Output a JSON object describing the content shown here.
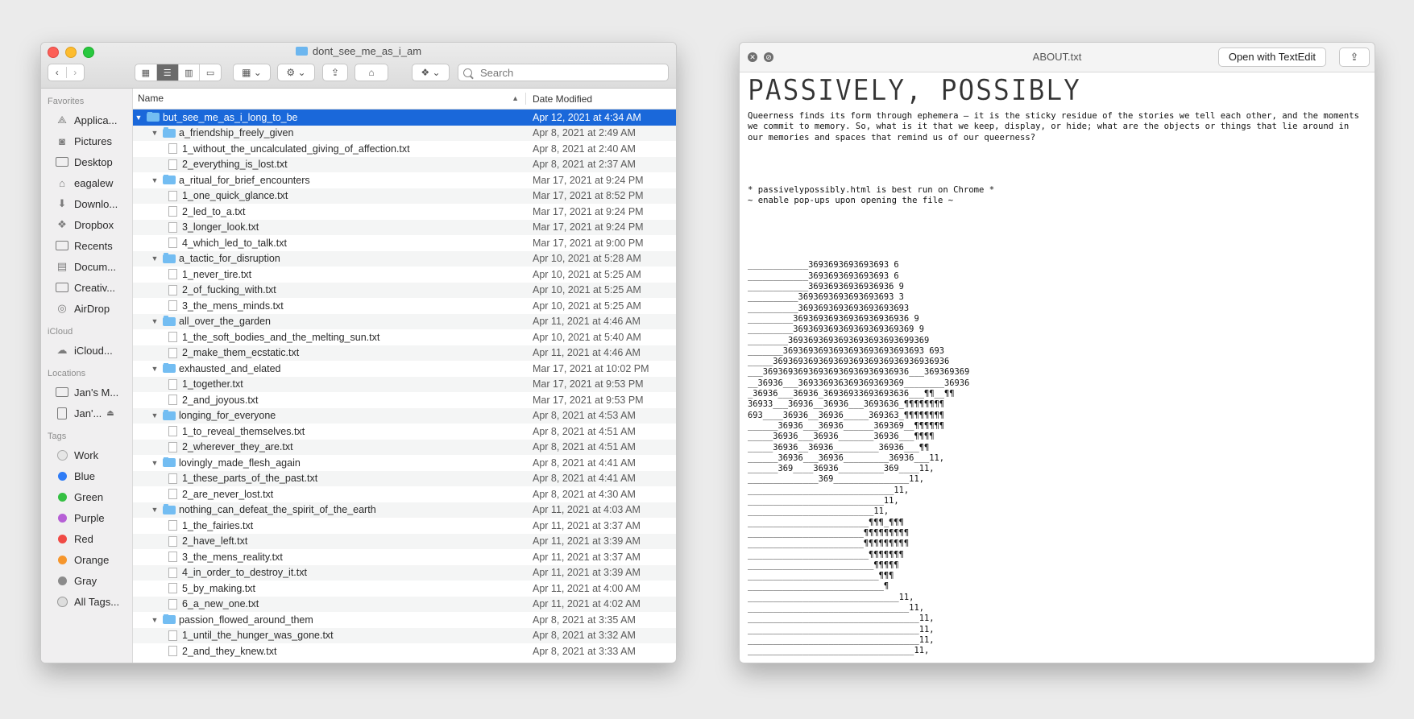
{
  "finder": {
    "window_title": "dont_see_me_as_i_am",
    "search_placeholder": "Search",
    "columns": {
      "name": "Name",
      "date": "Date Modified"
    },
    "sidebar": {
      "favorites_header": "Favorites",
      "favorites": [
        {
          "label": "Applica...",
          "icon": "applications-icon"
        },
        {
          "label": "Pictures",
          "icon": "pictures-icon"
        },
        {
          "label": "Desktop",
          "icon": "desktop-icon"
        },
        {
          "label": "eagalew",
          "icon": "home-icon"
        },
        {
          "label": "Downlo...",
          "icon": "downloads-icon"
        },
        {
          "label": "Dropbox",
          "icon": "dropbox-icon"
        },
        {
          "label": "Recents",
          "icon": "recents-icon"
        },
        {
          "label": "Docum...",
          "icon": "documents-icon"
        },
        {
          "label": "Creativ...",
          "icon": "folder-icon"
        },
        {
          "label": "AirDrop",
          "icon": "airdrop-icon"
        }
      ],
      "icloud_header": "iCloud",
      "icloud": [
        {
          "label": "iCloud...",
          "icon": "cloud-icon"
        }
      ],
      "locations_header": "Locations",
      "locations": [
        {
          "label": "Jan's M...",
          "icon": "computer-icon"
        },
        {
          "label": "Jan'...",
          "icon": "disk-icon"
        }
      ],
      "tags_header": "Tags",
      "tags": [
        {
          "label": "Work",
          "color": "#e6e6e6"
        },
        {
          "label": "Blue",
          "color": "#2f7cf6"
        },
        {
          "label": "Green",
          "color": "#35c043"
        },
        {
          "label": "Purple",
          "color": "#b65fd6"
        },
        {
          "label": "Red",
          "color": "#f04a45"
        },
        {
          "label": "Orange",
          "color": "#f6962c"
        },
        {
          "label": "Gray",
          "color": "#8b8b8b"
        },
        {
          "label": "All Tags...",
          "color": ""
        }
      ]
    },
    "rows": [
      {
        "level": 0,
        "type": "folder",
        "name": "but_see_me_as_i_long_to_be",
        "date": "Apr 12, 2021 at 4:34 AM",
        "selected": true
      },
      {
        "level": 1,
        "type": "folder",
        "name": "a_friendship_freely_given",
        "date": "Apr 8, 2021 at 2:49 AM"
      },
      {
        "level": 2,
        "type": "file",
        "name": "1_without_the_uncalculated_giving_of_affection.txt",
        "date": "Apr 8, 2021 at 2:40 AM"
      },
      {
        "level": 2,
        "type": "file",
        "name": "2_everything_is_lost.txt",
        "date": "Apr 8, 2021 at 2:37 AM"
      },
      {
        "level": 1,
        "type": "folder",
        "name": "a_ritual_for_brief_encounters",
        "date": "Mar 17, 2021 at 9:24 PM"
      },
      {
        "level": 2,
        "type": "file",
        "name": "1_one_quick_glance.txt",
        "date": "Mar 17, 2021 at 8:52 PM"
      },
      {
        "level": 2,
        "type": "file",
        "name": "2_led_to_a.txt",
        "date": "Mar 17, 2021 at 9:24 PM"
      },
      {
        "level": 2,
        "type": "file",
        "name": "3_longer_look.txt",
        "date": "Mar 17, 2021 at 9:24 PM"
      },
      {
        "level": 2,
        "type": "file",
        "name": "4_which_led_to_talk.txt",
        "date": "Mar 17, 2021 at 9:00 PM"
      },
      {
        "level": 1,
        "type": "folder",
        "name": "a_tactic_for_disruption",
        "date": "Apr 10, 2021 at 5:28 AM"
      },
      {
        "level": 2,
        "type": "file",
        "name": "1_never_tire.txt",
        "date": "Apr 10, 2021 at 5:25 AM"
      },
      {
        "level": 2,
        "type": "file",
        "name": "2_of_fucking_with.txt",
        "date": "Apr 10, 2021 at 5:25 AM"
      },
      {
        "level": 2,
        "type": "file",
        "name": "3_the_mens_minds.txt",
        "date": "Apr 10, 2021 at 5:25 AM"
      },
      {
        "level": 1,
        "type": "folder",
        "name": "all_over_the_garden",
        "date": "Apr 11, 2021 at 4:46 AM"
      },
      {
        "level": 2,
        "type": "file",
        "name": "1_the_soft_bodies_and_the_melting_sun.txt",
        "date": "Apr 10, 2021 at 5:40 AM"
      },
      {
        "level": 2,
        "type": "file",
        "name": "2_make_them_ecstatic.txt",
        "date": "Apr 11, 2021 at 4:46 AM"
      },
      {
        "level": 1,
        "type": "folder",
        "name": "exhausted_and_elated",
        "date": "Mar 17, 2021 at 10:02 PM"
      },
      {
        "level": 2,
        "type": "file",
        "name": "1_together.txt",
        "date": "Mar 17, 2021 at 9:53 PM"
      },
      {
        "level": 2,
        "type": "file",
        "name": "2_and_joyous.txt",
        "date": "Mar 17, 2021 at 9:53 PM"
      },
      {
        "level": 1,
        "type": "folder",
        "name": "longing_for_everyone",
        "date": "Apr 8, 2021 at 4:53 AM"
      },
      {
        "level": 2,
        "type": "file",
        "name": "1_to_reveal_themselves.txt",
        "date": "Apr 8, 2021 at 4:51 AM"
      },
      {
        "level": 2,
        "type": "file",
        "name": "2_wherever_they_are.txt",
        "date": "Apr 8, 2021 at 4:51 AM"
      },
      {
        "level": 1,
        "type": "folder",
        "name": "lovingly_made_flesh_again",
        "date": "Apr 8, 2021 at 4:41 AM"
      },
      {
        "level": 2,
        "type": "file",
        "name": "1_these_parts_of_the_past.txt",
        "date": "Apr 8, 2021 at 4:41 AM"
      },
      {
        "level": 2,
        "type": "file",
        "name": "2_are_never_lost.txt",
        "date": "Apr 8, 2021 at 4:30 AM"
      },
      {
        "level": 1,
        "type": "folder",
        "name": "nothing_can_defeat_the_spirit_of_the_earth",
        "date": "Apr 11, 2021 at 4:03 AM"
      },
      {
        "level": 2,
        "type": "file",
        "name": "1_the_fairies.txt",
        "date": "Apr 11, 2021 at 3:37 AM"
      },
      {
        "level": 2,
        "type": "file",
        "name": "2_have_left.txt",
        "date": "Apr 11, 2021 at 3:39 AM"
      },
      {
        "level": 2,
        "type": "file",
        "name": "3_the_mens_reality.txt",
        "date": "Apr 11, 2021 at 3:37 AM"
      },
      {
        "level": 2,
        "type": "file",
        "name": "4_in_order_to_destroy_it.txt",
        "date": "Apr 11, 2021 at 3:39 AM"
      },
      {
        "level": 2,
        "type": "file",
        "name": "5_by_making.txt",
        "date": "Apr 11, 2021 at 4:00 AM"
      },
      {
        "level": 2,
        "type": "file",
        "name": "6_a_new_one.txt",
        "date": "Apr 11, 2021 at 4:02 AM"
      },
      {
        "level": 1,
        "type": "folder",
        "name": "passion_flowed_around_them",
        "date": "Apr 8, 2021 at 3:35 AM"
      },
      {
        "level": 2,
        "type": "file",
        "name": "1_until_the_hunger_was_gone.txt",
        "date": "Apr 8, 2021 at 3:32 AM"
      },
      {
        "level": 2,
        "type": "file",
        "name": "2_and_they_knew.txt",
        "date": "Apr 8, 2021 at 3:33 AM"
      }
    ]
  },
  "quicklook": {
    "title": "ABOUT.txt",
    "open_button": "Open with TextEdit",
    "share_icon": "share-icon",
    "heading": "PASSIVELY, POSSIBLY",
    "paragraph": "Queerness finds its form through ephemera – it is the sticky residue of the stories we tell each other, and the moments we commit to memory. So, what is it that we keep, display, or hide; what are the objects or things that lie around in our memories and spaces that remind us of our queerness?",
    "note": "* passivelypossibly.html is best run on Chrome *\n~ enable pop-ups upon opening the file ~",
    "ascii_art": "____________3693693693693693 6\n____________3693693693693693 6\n____________36936936936936936 9\n__________3693693693693693693 3\n__________3693693693693693693693\n_________36936936936936936936936 9\n_________369369369369369369369369 9\n________3693693693693693693693699369\n_______3693693693693693693693693693 693\n_____36936936936936936936936936936936936\n___36936936936936936936936936936___369369369\n__36936___369336936369369369369________36936\n_36936___36936_36936933693693636___¶¶__¶¶\n36933___36936__36936___3693636_¶¶¶¶¶¶¶¶\n693____36936__36936_____369363_¶¶¶¶¶¶¶¶\n______36936___36936______369369__¶¶¶¶¶¶\n_____36936___36936_______36936___¶¶¶¶\n_____36936__36936_________36936___¶¶\n______36936___36936_________36936___11,\n______369____36936_________369____11,\n______________369_______________11,\n_____________________________11,\n___________________________11,\n_________________________11,\n________________________¶¶¶_¶¶¶\n_______________________¶¶¶¶¶¶¶¶¶\n_______________________¶¶¶¶¶¶¶¶¶\n________________________¶¶¶¶¶¶¶\n_________________________¶¶¶¶¶\n__________________________¶¶¶\n___________________________¶\n______________________________11,\n________________________________11,\n__________________________________11,\n__________________________________11,\n__________________________________11,\n_________________________________11,"
  }
}
